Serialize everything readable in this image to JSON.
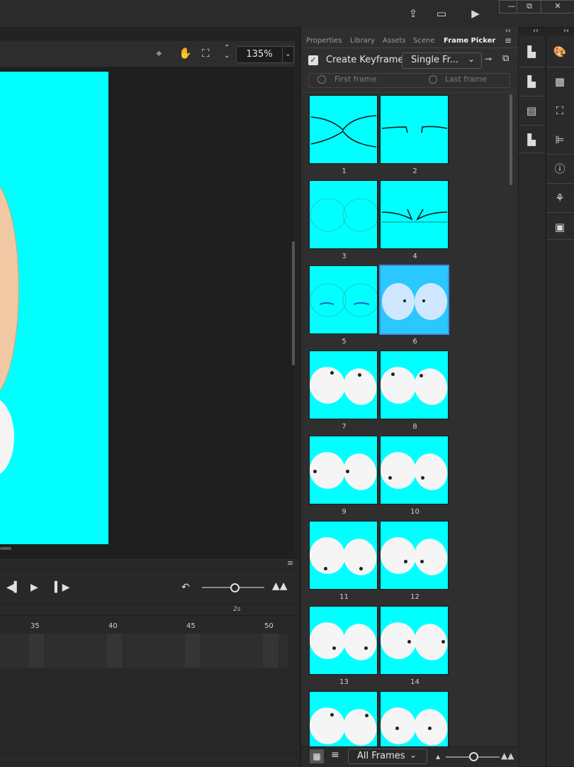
{
  "window": {
    "minimize": "—",
    "restore": "⧉",
    "close": "✕"
  },
  "stage": {
    "zoom": "135%"
  },
  "timeline": {
    "ruler_numbers": [
      "35",
      "40",
      "45",
      "50"
    ],
    "time_label": "2s"
  },
  "panel": {
    "tabs": [
      "Properties",
      "Library",
      "Assets",
      "Scene",
      "Frame Picker"
    ],
    "create_keyframe_label": "Create Keyframe",
    "mode_select": "Single Fr...",
    "first_frame_label": "First frame",
    "last_frame_label": "Last frame",
    "frame_numbers": [
      "1",
      "2",
      "3",
      "4",
      "5",
      "6",
      "7",
      "8",
      "9",
      "10",
      "11",
      "12",
      "13",
      "14"
    ],
    "filter_select": "All Frames"
  },
  "colors": {
    "accent": "#3a8ee6",
    "canvas": "#00ffff"
  }
}
